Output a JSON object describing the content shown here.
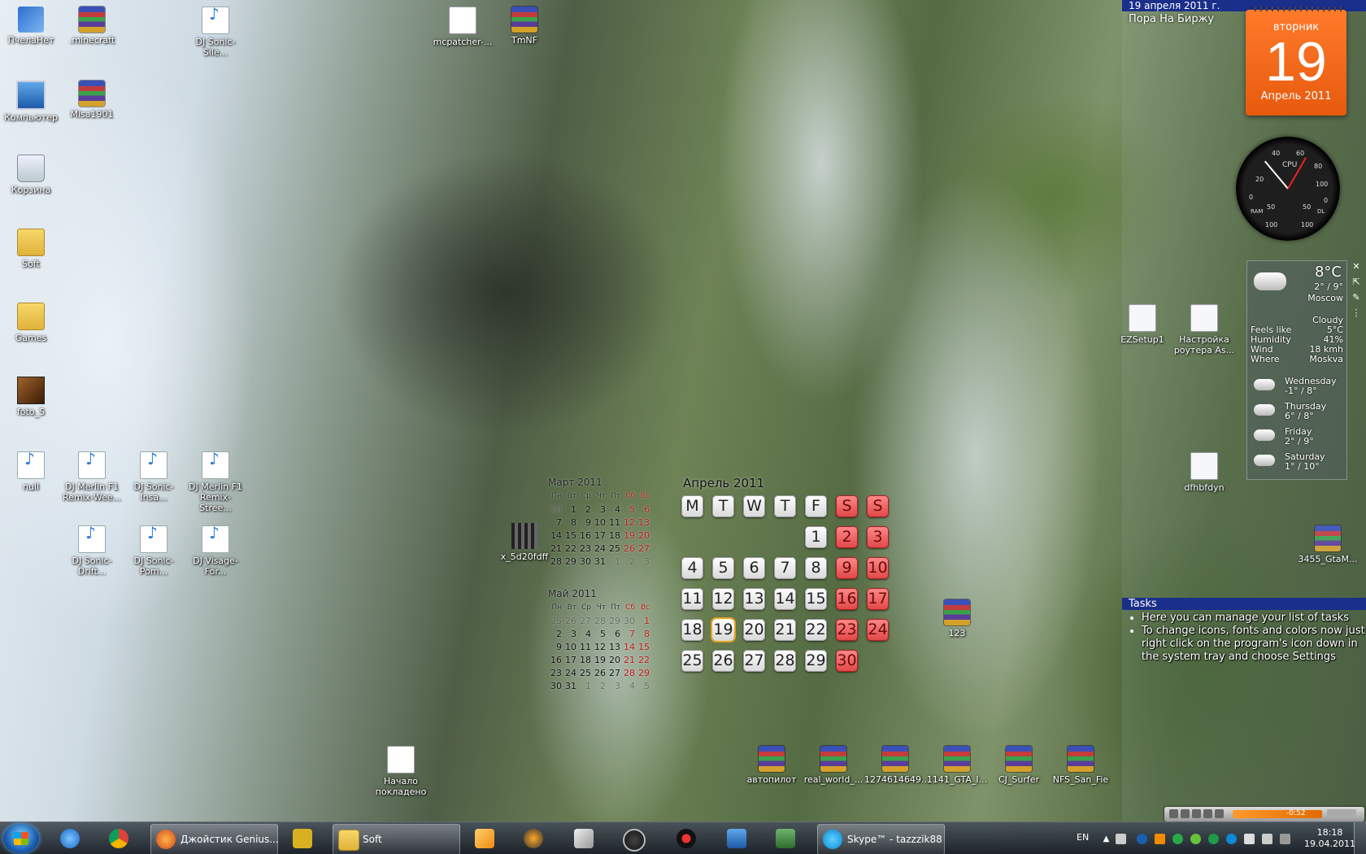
{
  "desktop_icons": [
    {
      "label": "ПчелаНет",
      "icon": "network-app-icon"
    },
    {
      "label": ".minecraft",
      "icon": "winrar-archive-icon"
    },
    {
      "label": "DJ Sonic-Sile...",
      "icon": "mp3-file-icon"
    },
    {
      "label": "mcpatcher-...",
      "icon": "document-icon"
    },
    {
      "label": "TmNF",
      "icon": "winrar-archive-icon"
    },
    {
      "label": "Компьютер",
      "icon": "computer-icon"
    },
    {
      "label": "Misa1901",
      "icon": "winrar-archive-icon"
    },
    {
      "label": "Корзина",
      "icon": "recycle-bin-icon"
    },
    {
      "label": "Soft",
      "icon": "folder-icon"
    },
    {
      "label": "Games",
      "icon": "folder-icon"
    },
    {
      "label": "foto_5",
      "icon": "photo-icon"
    },
    {
      "label": "null",
      "icon": "mp3-file-icon"
    },
    {
      "label": "DJ Merlin F1 Remix-Wee...",
      "icon": "mp3-file-icon"
    },
    {
      "label": "DJ Sonic-Insa...",
      "icon": "mp3-file-icon"
    },
    {
      "label": "DJ Merlin F1 Remix-Stree...",
      "icon": "mp3-file-icon"
    },
    {
      "label": "DJ Sonic-Drift...",
      "icon": "mp3-file-icon"
    },
    {
      "label": "DJ Sonic-Pom...",
      "icon": "mp3-file-icon"
    },
    {
      "label": "DJ Visage-For...",
      "icon": "mp3-file-icon"
    },
    {
      "label": "x_5d20fdff",
      "icon": "video-file-icon"
    },
    {
      "label": "Начало покладено",
      "icon": "document-icon"
    },
    {
      "label": "автопилот",
      "icon": "winrar-archive-icon"
    },
    {
      "label": "real_world_...",
      "icon": "winrar-archive-icon"
    },
    {
      "label": "1274614649...",
      "icon": "winrar-archive-icon"
    },
    {
      "label": "1141_GTA_I...",
      "icon": "winrar-archive-icon"
    },
    {
      "label": "CJ_Surfer",
      "icon": "winrar-archive-icon"
    },
    {
      "label": "NFS_San_Fie",
      "icon": "winrar-archive-icon"
    },
    {
      "label": "123",
      "icon": "winrar-archive-icon"
    },
    {
      "label": "EZSetup1",
      "icon": "document-icon"
    },
    {
      "label": "Настройка роутера As...",
      "icon": "document-icon"
    },
    {
      "label": "dfhbfdyn",
      "icon": "document-icon"
    },
    {
      "label": "3455_GtaM...",
      "icon": "winrar-archive-icon"
    }
  ],
  "mini_calendars": [
    {
      "title": "Март 2011",
      "headers": [
        "Пн",
        "Вт",
        "Ср",
        "Чт",
        "Пт",
        "Сб",
        "Вс"
      ],
      "weeks": [
        [
          "28",
          "1",
          "2",
          "3",
          "4",
          "5",
          "6"
        ],
        [
          "7",
          "8",
          "9",
          "10",
          "11",
          "12",
          "13"
        ],
        [
          "14",
          "15",
          "16",
          "17",
          "18",
          "19",
          "20"
        ],
        [
          "21",
          "22",
          "23",
          "24",
          "25",
          "26",
          "27"
        ],
        [
          "28",
          "29",
          "30",
          "31",
          "1",
          "2",
          "3"
        ]
      ]
    },
    {
      "title": "Май 2011",
      "headers": [
        "Пн",
        "Вт",
        "Ср",
        "Чт",
        "Пт",
        "Сб",
        "Вс"
      ],
      "weeks": [
        [
          "25",
          "26",
          "27",
          "28",
          "29",
          "30",
          "1"
        ],
        [
          "2",
          "3",
          "4",
          "5",
          "6",
          "7",
          "8"
        ],
        [
          "9",
          "10",
          "11",
          "12",
          "13",
          "14",
          "15"
        ],
        [
          "16",
          "17",
          "18",
          "19",
          "20",
          "21",
          "22"
        ],
        [
          "23",
          "24",
          "25",
          "26",
          "27",
          "28",
          "29"
        ],
        [
          "30",
          "31",
          "1",
          "2",
          "3",
          "4",
          "5"
        ]
      ]
    }
  ],
  "big_calendar": {
    "title": "Апрель 2011",
    "headers": [
      "M",
      "T",
      "W",
      "T",
      "F",
      "S",
      "S"
    ],
    "weeks": [
      [
        "",
        "",
        "",
        "",
        "1",
        "2",
        "3"
      ],
      [
        "4",
        "5",
        "6",
        "7",
        "8",
        "9",
        "10"
      ],
      [
        "11",
        "12",
        "13",
        "14",
        "15",
        "16",
        "17"
      ],
      [
        "18",
        "19",
        "20",
        "21",
        "22",
        "23",
        "24"
      ],
      [
        "25",
        "26",
        "27",
        "28",
        "29",
        "30",
        ""
      ]
    ],
    "today": "19"
  },
  "stocks_gadget": {
    "date": "19 апреля 2011 г.",
    "headline": "Пора На Биржу"
  },
  "tear_calendar": {
    "weekday": "вторник",
    "day": "19",
    "month_year": "Апрель 2011"
  },
  "cpu_gauge": {
    "title": "CPU",
    "labels": [
      "20",
      "40",
      "60",
      "80",
      "0",
      "100",
      "RAM",
      "50",
      "100",
      "DL",
      "50",
      "100",
      "0"
    ]
  },
  "weather": {
    "temp": "8°C",
    "range": "2° / 9°",
    "city": "Moscow",
    "condition": "Cloudy",
    "details": [
      {
        "k": "Feels like",
        "v": "5°C"
      },
      {
        "k": "Humidity",
        "v": "41%"
      },
      {
        "k": "Wind",
        "v": "18 kmh"
      },
      {
        "k": "Where",
        "v": "Moskva"
      }
    ],
    "forecast": [
      {
        "day": "Wednesday",
        "range": "-1° / 8°"
      },
      {
        "day": "Thursday",
        "range": "6° / 8°"
      },
      {
        "day": "Friday",
        "range": "2° / 9°"
      },
      {
        "day": "Saturday",
        "range": "1° / 10°"
      }
    ]
  },
  "tasks_gadget": {
    "title": "Tasks",
    "items": [
      "Here you can manage your list of tasks",
      "To change icons, fonts and colors now just right click on the program's icon down in the system tray and choose Settings"
    ]
  },
  "media_player": {
    "time": "-0:52"
  },
  "taskbar": {
    "pinned": [
      "internet-explorer-icon",
      "chrome-icon"
    ],
    "windows": [
      {
        "label": "Джойстик Genius...",
        "icon": "firefox-icon"
      },
      {
        "label": "Soft",
        "icon": "folder-icon"
      },
      {
        "label": "Skype™ - tazzzik88",
        "icon": "skype-icon"
      }
    ],
    "apps": [
      "lizard-app-icon",
      "media-player-icon",
      "vlc-icon",
      "box-app-icon",
      "clock-app-icon",
      "record-app-icon",
      "network-app-icon",
      "monitor-app-icon"
    ],
    "tray": {
      "lang": "EN",
      "time": "18:18",
      "date": "19.04.2011"
    }
  },
  "colors": {
    "gadget_bar": "#1a2f8a",
    "tear_calendar": "#ff6a1e",
    "weekend_red": "#e04646",
    "today_ring": "#e6a21c"
  }
}
